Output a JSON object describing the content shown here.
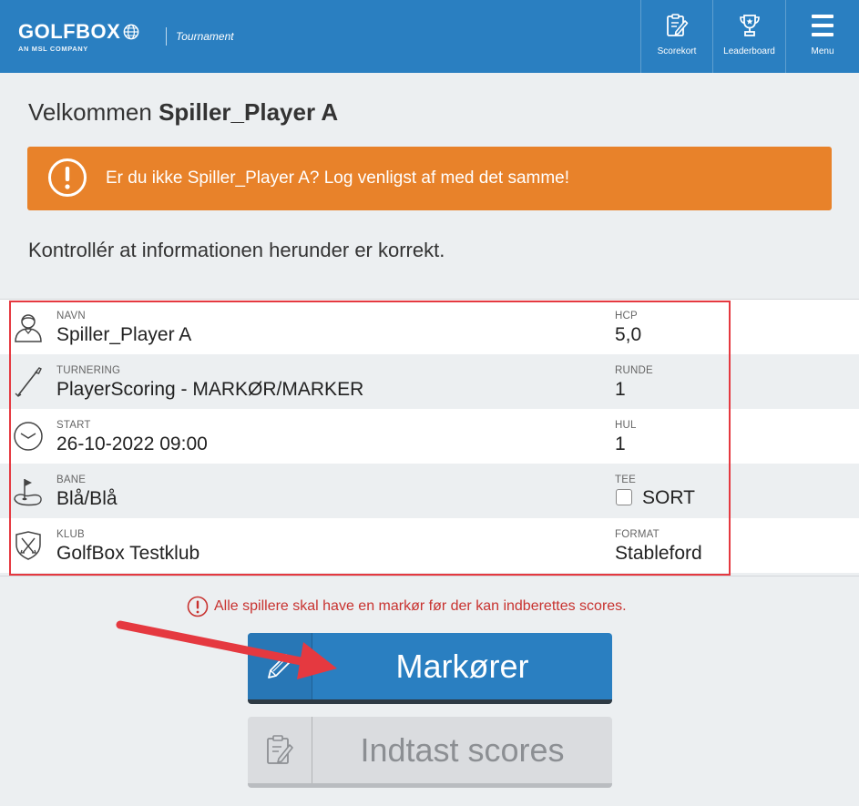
{
  "header": {
    "logo_text": "GOLFBOX",
    "logo_subtext": "AN MSL COMPANY",
    "app_label": "Tournament",
    "nav": [
      {
        "label": "Scorekort",
        "icon": "clipboard-pen-icon"
      },
      {
        "label": "Leaderboard",
        "icon": "trophy-icon"
      },
      {
        "label": "Menu",
        "icon": "hamburger-menu-icon"
      }
    ],
    "color": "#2a7fc1"
  },
  "welcome": {
    "prefix": "Velkommen",
    "player_name": "Spiller_Player A"
  },
  "alert": {
    "text": "Er du ikke Spiller_Player A? Log venligst af med det samme!",
    "icon": "exclamation-circle-icon",
    "color": "#e8822a"
  },
  "subtitle": "Kontrollér at informationen herunder er korrekt.",
  "info": {
    "rows": [
      {
        "icon": "person-icon",
        "label1": "NAVN",
        "value1": "Spiller_Player A",
        "label2": "HCP",
        "value2": "5,0"
      },
      {
        "icon": "golf-club-icon",
        "label1": "TURNERING",
        "value1": "PlayerScoring - MARKØR/MARKER",
        "label2": "RUNDE",
        "value2": "1"
      },
      {
        "icon": "clock-icon",
        "label1": "START",
        "value1": "26-10-2022 09:00",
        "label2": "HUL",
        "value2": "1"
      },
      {
        "icon": "golf-flag-icon",
        "label1": "BANE",
        "value1": "Blå/Blå",
        "label2": "TEE",
        "value2": "SORT"
      },
      {
        "icon": "club-shield-icon",
        "label1": "KLUB",
        "value1": "GolfBox Testklub",
        "label2": "FORMAT",
        "value2": "Stableford"
      }
    ]
  },
  "warning": {
    "text": "Alle spillere skal have en markør før der kan indberettes scores.",
    "icon": "exclamation-circle-icon",
    "color": "#c8322f"
  },
  "buttons": {
    "markers": {
      "label": "Markører",
      "icon": "pencil-icon"
    },
    "enter_scores": {
      "label": "Indtast scores",
      "icon": "clipboard-pen-icon"
    }
  },
  "annotation": {
    "highlight_color": "#e53940"
  }
}
